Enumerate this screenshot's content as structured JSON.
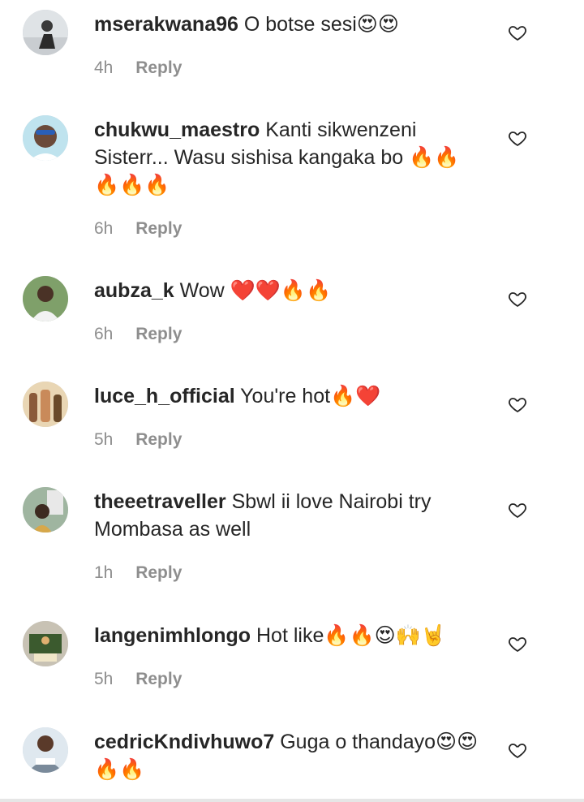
{
  "comments": [
    {
      "username": "mserakwana96",
      "text": "O botse sesi😍😍",
      "time": "4h",
      "reply_label": "Reply",
      "avatar_icon": "profile-photo"
    },
    {
      "username": "chukwu_maestro",
      "text": "Kanti sikwenzeni Sisterr... Wasu sishisa kangaka bo 🔥🔥🔥🔥🔥",
      "time": "6h",
      "reply_label": "Reply",
      "avatar_icon": "profile-photo"
    },
    {
      "username": "aubza_k",
      "text": "Wow ❤️❤️🔥🔥",
      "time": "6h",
      "reply_label": "Reply",
      "avatar_icon": "profile-photo"
    },
    {
      "username": "luce_h_official",
      "text": "You're hot🔥❤️",
      "time": "5h",
      "reply_label": "Reply",
      "avatar_icon": "profile-photo"
    },
    {
      "username": "theeetraveller",
      "text": "Sbwl ii love Nairobi try Mombasa as well",
      "time": "1h",
      "reply_label": "Reply",
      "avatar_icon": "profile-photo"
    },
    {
      "username": "langenimhlongo",
      "text": "Hot like🔥🔥😍🙌🤘",
      "time": "5h",
      "reply_label": "Reply",
      "avatar_icon": "profile-photo"
    },
    {
      "username": "cedricKndivhuwo7",
      "text": "Guga o thandayo😍😍🔥🔥",
      "time": "",
      "reply_label": "",
      "avatar_icon": "profile-photo"
    }
  ],
  "icons": {
    "like": "heart-outline-icon"
  },
  "colors": {
    "text": "#262626",
    "secondary": "#8e8e8e"
  }
}
